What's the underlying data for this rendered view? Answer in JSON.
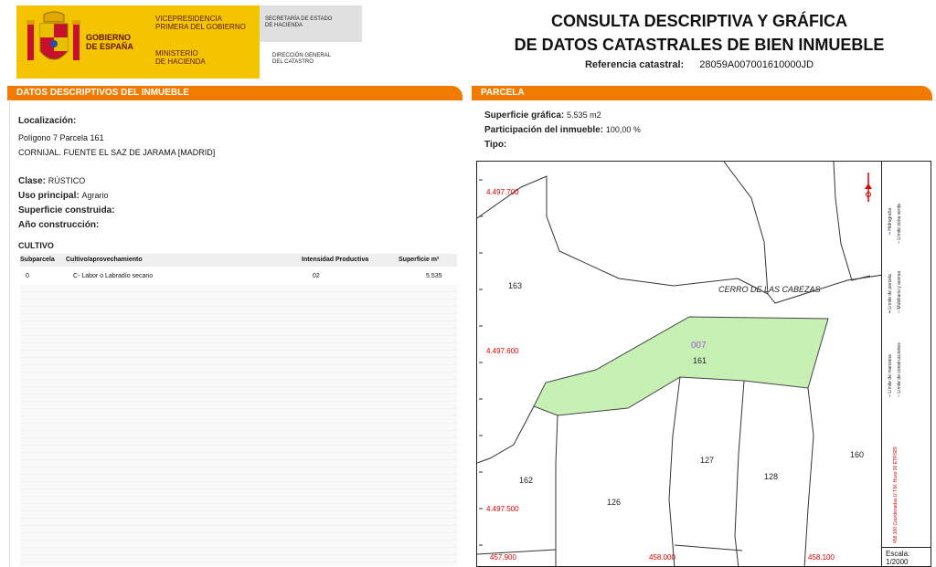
{
  "header": {
    "gov_line1": "GOBIERNO",
    "gov_line2": "DE ESPAÑA",
    "vice_line1": "VICEPRESIDENCIA",
    "vice_line2": "PRIMERA DEL GOBIERNO",
    "min_line1": "MINISTERIO",
    "min_line2": "DE HACIENDA",
    "sec_line1": "SECRETARÍA DE ESTADO",
    "sec_line2": "DE HACIENDA",
    "dir_line1": "DIRECCIÓN GENERAL",
    "dir_line2": "DEL CATASTRO",
    "title_line1": "CONSULTA DESCRIPTIVA Y GRÁFICA",
    "title_line2": "DE DATOS CATASTRALES DE BIEN INMUEBLE",
    "ref_label": "Referencia catastral:",
    "ref_value": "28059A007001610000JD"
  },
  "descriptive": {
    "section_title": "DATOS DESCRIPTIVOS DEL INMUEBLE",
    "localizacion_label": "Localización:",
    "localizacion_line1": "Polígono 7 Parcela 161",
    "localizacion_line2": "CORNIJAL. FUENTE EL SAZ DE JARAMA [MADRID]",
    "clase_label": "Clase:",
    "clase_value": "RÚSTICO",
    "uso_label": "Uso principal:",
    "uso_value": "Agrario",
    "superficie_label": "Superficie construida:",
    "anio_label": "Año construcción:",
    "cultivo_title": "CULTIVO",
    "columns": [
      "Subparcela",
      "Cultivo/aprovechamiento",
      "Intensidad Productiva",
      "Superficie m²"
    ],
    "rows": [
      {
        "subparcela": "0",
        "cultivo": "C- Labor o Labradío secano",
        "intensidad": "02",
        "superficie": "5.535"
      }
    ]
  },
  "parcela": {
    "section_title": "PARCELA",
    "sup_label": "Superficie gráfica:",
    "sup_value": "5.535 m2",
    "part_label": "Participación del inmueble:",
    "part_value": "100,00 %",
    "tipo_label": "Tipo:"
  },
  "map": {
    "y_labels": [
      "4.497.700",
      "4.497.600",
      "4.497.500"
    ],
    "x_labels": [
      "457.900",
      "458.000",
      "458.100"
    ],
    "toponym": "CERRO DE LAS  CABEZAS",
    "parcel_code": "007",
    "parcel_labels": [
      "163",
      "161",
      "162",
      "126",
      "127",
      "128",
      "160"
    ],
    "parcel_fill": "#c7f0b4"
  },
  "legend": {
    "items": [
      "Hidrografía",
      "Límite zona verde",
      "Límite de parcela",
      "Mobiliario y aceras",
      "Límite de manzana",
      "Límite de construcciones"
    ],
    "coords": "458,100 Coordenadas U.T.M. Huso 30 ETRS89",
    "scale_label": "Escala:",
    "scale_value": "1/2000"
  }
}
